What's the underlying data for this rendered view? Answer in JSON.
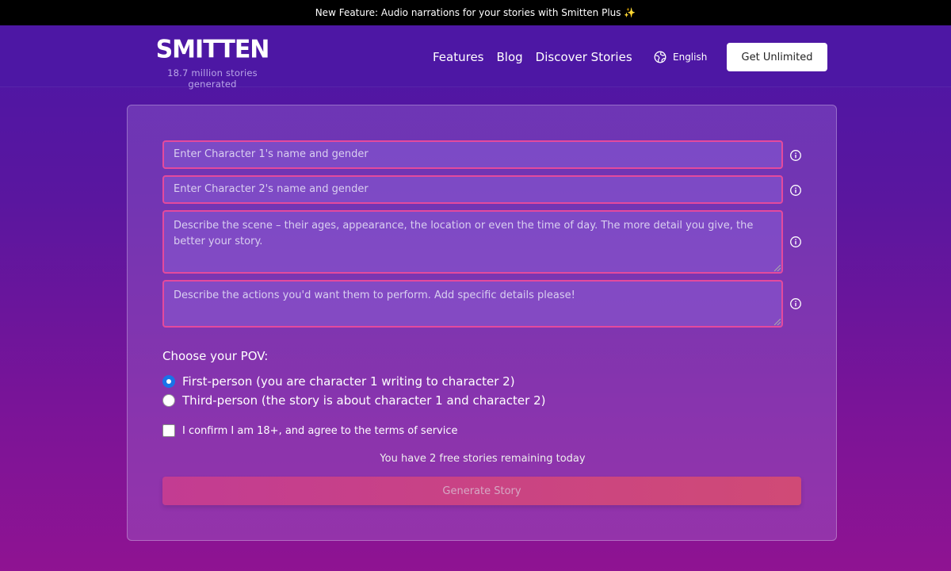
{
  "announcement": {
    "text": "New Feature: Audio narrations for your stories with Smitten Plus ✨"
  },
  "header": {
    "logo": "SMITTEN",
    "tagline": "18.7 million stories generated",
    "nav": [
      "Features",
      "Blog",
      "Discover Stories"
    ],
    "language": "English",
    "cta_label": "Get Unlimited"
  },
  "form": {
    "character1_placeholder": "Enter Character 1's name and gender",
    "character2_placeholder": "Enter Character 2's name and gender",
    "scene_placeholder": "Describe the scene – their ages, appearance, the location or even the time of day. The more detail you give, the better your story.",
    "actions_placeholder": "Describe the actions you'd want them to perform. Add specific details please!",
    "pov_title": "Choose your POV:",
    "pov_options": [
      {
        "label": "First-person (you are character 1 writing to character 2)",
        "selected": true
      },
      {
        "label": "Third-person (the story is about character 1 and character 2)",
        "selected": false
      }
    ],
    "confirm_label": "I confirm I am 18+, and agree to the terms of service",
    "confirm_checked": false,
    "remaining_text": "You have 2 free stories remaining today",
    "generate_label": "Generate Story"
  },
  "icons": {
    "info": "info-circle-icon",
    "language": "globe-icon"
  },
  "colors": {
    "field_border": "#e44a9d",
    "radio_selected": "#1a73e8",
    "button_gradient_start": "#c33c92",
    "button_gradient_end": "#d04a76"
  }
}
